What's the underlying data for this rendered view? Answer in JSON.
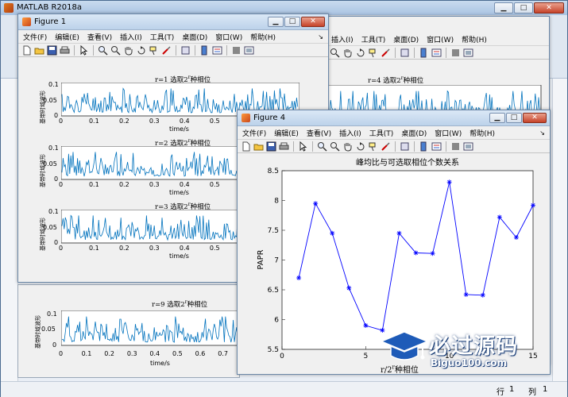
{
  "matlab": {
    "title": "MATLAB R2018a",
    "status_row_label": "行",
    "status_row_value": "1",
    "status_col_label": "列",
    "status_col_value": "1"
  },
  "figure1": {
    "title": "Figure 1",
    "menus": [
      "文件(F)",
      "编辑(E)",
      "查看(V)",
      "插入(I)",
      "工具(T)",
      "桌面(D)",
      "窗口(W)",
      "帮助(H)"
    ],
    "subplots": [
      {
        "title_pre": "r=1 选取2",
        "title_sup": "r",
        "title_post": "种相位",
        "ylabel": "基带时域波形",
        "xlabel": "time/s"
      },
      {
        "title_pre": "r=2 选取2",
        "title_sup": "r",
        "title_post": "种相位",
        "ylabel": "基带时域波形",
        "xlabel": "time/s"
      },
      {
        "title_pre": "r=3 选取2",
        "title_sup": "r",
        "title_post": "种相位",
        "ylabel": "基带时域波形",
        "xlabel": "time/s"
      }
    ],
    "x_ticks": [
      "0",
      "0.1",
      "0.2",
      "0.3",
      "0.4",
      "0.5",
      "0.6",
      "0.7"
    ],
    "y_ticks": [
      "0.1",
      "0.05",
      "0"
    ]
  },
  "figure_back": {
    "menus": [
      "插入(I)",
      "工具(T)",
      "桌面(D)",
      "窗口(W)",
      "帮助(H)"
    ],
    "subplot_r4": {
      "title_pre": "r=4 选取2",
      "title_sup": "r",
      "title_post": "种相位"
    }
  },
  "lower_subplot": {
    "title_pre": "r=9 选取2",
    "title_sup": "r",
    "title_post": "种相位",
    "ylabel": "基带时域波形",
    "xlabel": "time/s",
    "x_ticks": [
      "0",
      "0.1",
      "0.2",
      "0.3",
      "0.4",
      "0.5",
      "0.6",
      "0.7"
    ],
    "y_ticks": [
      "0.1",
      "0.05",
      "0"
    ]
  },
  "figure4": {
    "title": "Figure 4",
    "menus": [
      "文件(F)",
      "编辑(E)",
      "查看(V)",
      "插入(I)",
      "工具(T)",
      "桌面(D)",
      "窗口(W)",
      "帮助(H)"
    ]
  },
  "chart_data": {
    "type": "line",
    "title": "峰均比与可选取相位个数关系",
    "xlabel_pre": "r/2",
    "xlabel_sup": "r",
    "xlabel_post": "种相位",
    "ylabel": "PAPR",
    "x": [
      1,
      2,
      3,
      4,
      5,
      6,
      7,
      8,
      9,
      10,
      11,
      12,
      13,
      14,
      15
    ],
    "values": [
      6.7,
      7.95,
      7.45,
      6.53,
      5.9,
      5.82,
      7.45,
      7.12,
      7.11,
      8.31,
      6.42,
      6.41,
      7.72,
      7.38,
      7.92
    ],
    "xlim": [
      0,
      15
    ],
    "ylim": [
      5.5,
      8.5
    ],
    "x_ticks": [
      "0",
      "5",
      "10",
      "15"
    ],
    "y_ticks": [
      "5.5",
      "6",
      "6.5",
      "7",
      "7.5",
      "8",
      "8.5"
    ],
    "line_color": "#0000ff",
    "marker": "asterisk",
    "grid": false
  },
  "watermark": {
    "text": "必过源码",
    "url": "Biguo100.com"
  },
  "colors": {
    "signal": "#0072bd",
    "papr_line": "#0000ff"
  }
}
